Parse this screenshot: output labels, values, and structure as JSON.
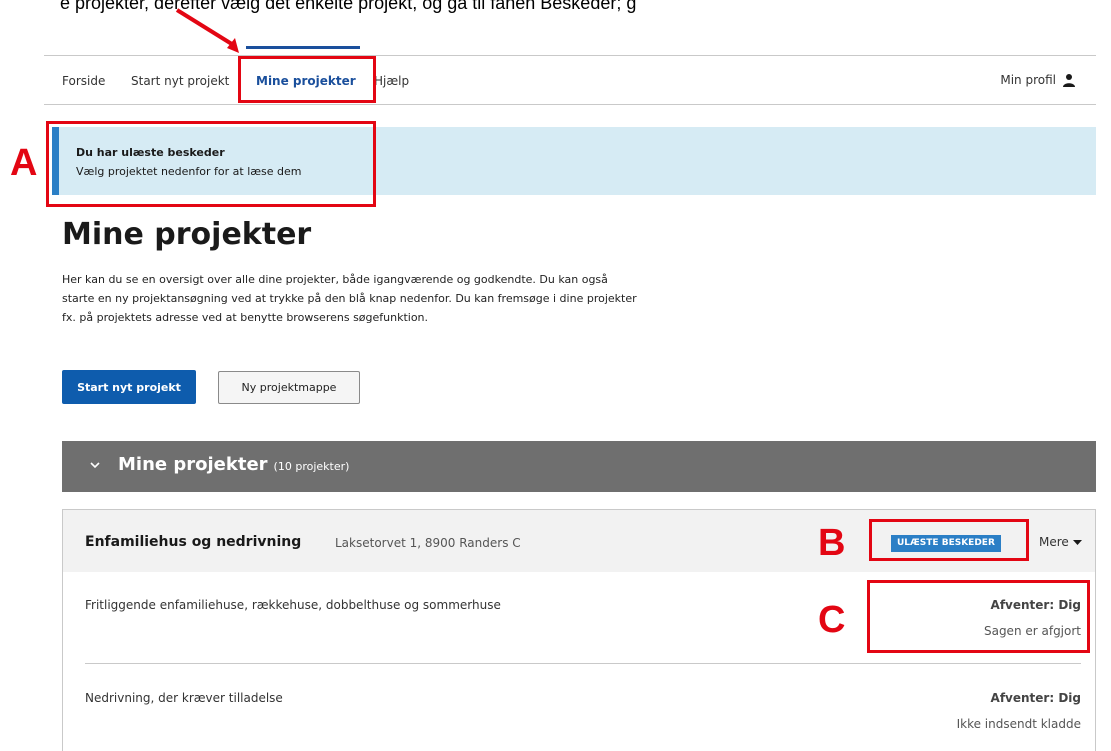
{
  "top_text": "e projekter, derefter vælg det enkelte projekt, og gå til fanen Beskeder; g",
  "nav": {
    "items": [
      "Forside",
      "Start nyt projekt",
      "Mine projekter",
      "Hjælp"
    ],
    "active": "Mine projekter",
    "profile_label": "Min profil",
    "profile_icon": "user-icon"
  },
  "alert": {
    "title": "Du har ulæste beskeder",
    "text": "Vælg projektet nedenfor for at læse dem"
  },
  "page": {
    "title": "Mine projekter",
    "intro": "Her kan du se en oversigt over alle dine projekter, både igangværende og godkendte. Du kan også starte en ny projektansøgning ved at trykke på den blå knap nedenfor. Du kan fremsøge i dine projekter fx. på projektets adresse ved at benytte browserens søgefunktion.",
    "primary_button": "Start nyt projekt",
    "secondary_button": "Ny projektmappe"
  },
  "group": {
    "title": "Mine projekter",
    "count": "(10 projekter)",
    "icon": "chevron-down-icon"
  },
  "project": {
    "title": "Enfamiliehus og nedrivning",
    "address": "Laksetorvet 1, 8900 Randers C",
    "badge": "ULÆSTE BESKEDER",
    "more_label": "Mere",
    "rows": [
      {
        "description": "Fritliggende enfamiliehuse, rækkehuse, dobbelthuse og sommerhuse",
        "waiting": "Afventer: Dig",
        "status": "Sagen er afgjort"
      },
      {
        "description": "Nedrivning, der kræver tilladelse",
        "waiting": "Afventer: Dig",
        "status": "Ikke indsendt kladde"
      }
    ]
  },
  "annotations": {
    "a": "A",
    "b": "B",
    "c": "C",
    "color": "#e30613"
  },
  "colors": {
    "primary": "#0e5cad",
    "nav_active": "#1a4f9c",
    "alert_bg": "#d6ebf4",
    "alert_bar": "#2b7fc6",
    "group_bg": "#6f6f6f"
  }
}
